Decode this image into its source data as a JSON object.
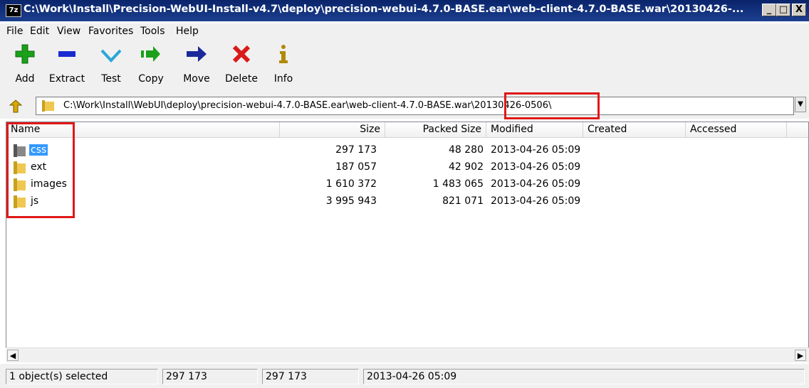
{
  "window": {
    "app_icon": "7z",
    "title": "C:\\Work\\Install\\Precision-WebUI-Install-v4.7\\deploy\\precision-webui-4.7.0-BASE.ear\\web-client-4.7.0-BASE.war\\20130426-...",
    "buttons": {
      "minimize": "_",
      "maximize": "□",
      "close": "X"
    }
  },
  "menu": [
    "File",
    "Edit",
    "View",
    "Favorites",
    "Tools",
    "Help"
  ],
  "toolbar": {
    "items": [
      {
        "label": "Add",
        "icon": "plus-icon",
        "color": "#1aa01a"
      },
      {
        "label": "Extract",
        "icon": "minus-icon",
        "color": "#1a2ad0"
      },
      {
        "label": "Test",
        "icon": "check-icon",
        "color": "#2aa6d8"
      },
      {
        "label": "Copy",
        "icon": "copy-arrow-icon",
        "color": "#1aa01a"
      },
      {
        "label": "Move",
        "icon": "move-arrow-icon",
        "color": "#1a2a9a"
      },
      {
        "label": "Delete",
        "icon": "delete-x-icon",
        "color": "#d81a1a"
      },
      {
        "label": "Info",
        "icon": "info-icon",
        "color": "#b08a00"
      }
    ]
  },
  "address": {
    "path": "C:\\Work\\Install\\WebUI\\deploy\\precision-webui-4.7.0-BASE.ear\\web-client-4.7.0-BASE.war\\20130426-0506\\"
  },
  "columns": {
    "name": "Name",
    "size": "Size",
    "packed": "Packed Size",
    "modified": "Modified",
    "created": "Created",
    "accessed": "Accessed"
  },
  "rows": [
    {
      "name": "css",
      "size": "297 173",
      "packed": "48 280",
      "modified": "2013-04-26 05:09",
      "selected": true
    },
    {
      "name": "ext",
      "size": "187 057",
      "packed": "42 902",
      "modified": "2013-04-26 05:09",
      "selected": false
    },
    {
      "name": "images",
      "size": "1 610 372",
      "packed": "1 483 065",
      "modified": "2013-04-26 05:09",
      "selected": false
    },
    {
      "name": "js",
      "size": "3 995 943",
      "packed": "821 071",
      "modified": "2013-04-26 05:09",
      "selected": false
    }
  ],
  "status": {
    "selection": "1 object(s) selected",
    "size": "297 173",
    "packed": "297 173",
    "modified": "2013-04-26 05:09"
  },
  "colors": {
    "title_bar": "#0a246a",
    "selection": "#3399ff",
    "highlight": "#e01818",
    "folder": "#e8b830"
  }
}
